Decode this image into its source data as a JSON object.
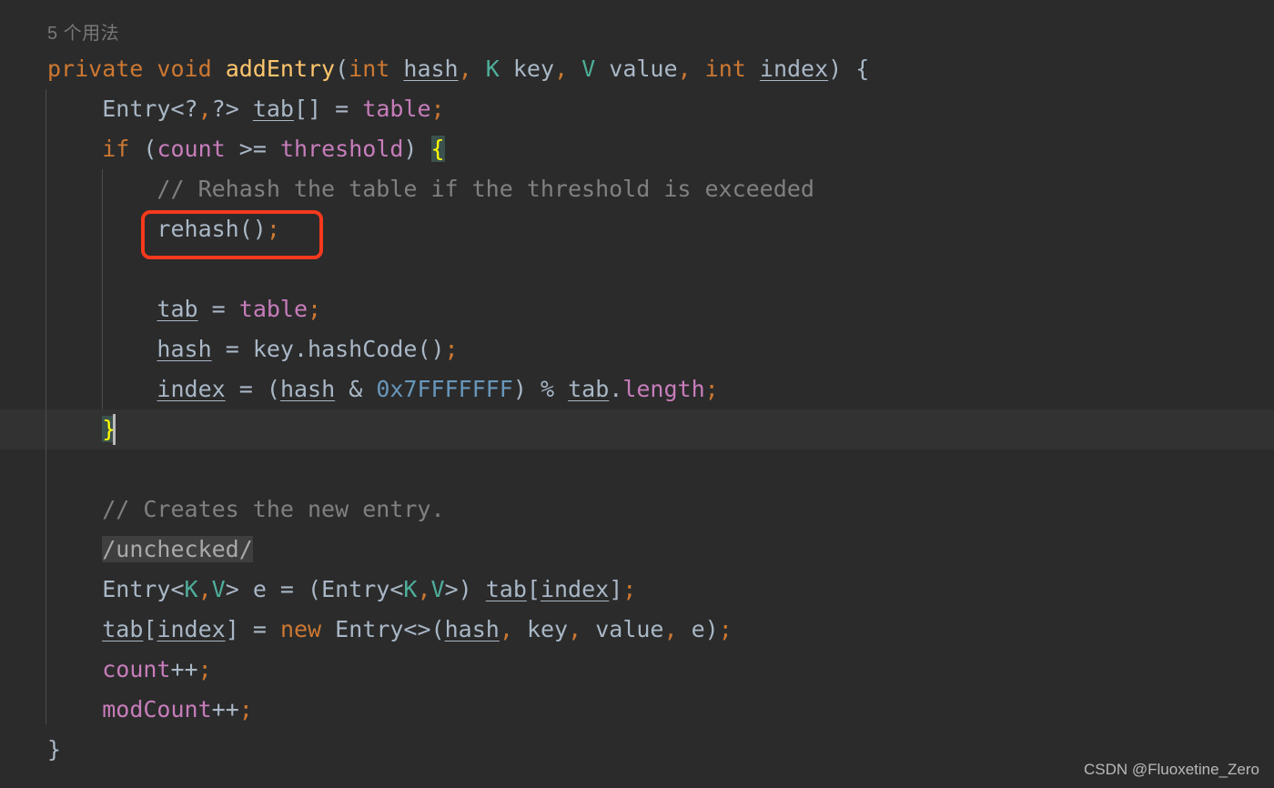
{
  "editor": {
    "background_color": "#2b2b2b",
    "current_line_color": "#323232",
    "code_vision_hint": "5 个用法",
    "watermark": "CSDN @Fluoxetine_Zero",
    "annotation": {
      "kind": "red-rectangle-highlight",
      "color": "#f5391d",
      "targets_line": 5,
      "target_text": "rehash();"
    },
    "caret": {
      "line": 10,
      "column": 5
    },
    "colors": {
      "keyword": "#cc7832",
      "method": "#ffc66d",
      "field": "#c77dbb",
      "default": "#a9b7c6",
      "generic_type": "#4eaf9a",
      "number": "#6897bb",
      "comment": "#808080",
      "brace_match_bg": "#3b514d",
      "brace_match_fg": "#ffff00",
      "folded_bg": "#3f3f3f",
      "accent_red": "#f5391d"
    }
  },
  "code": {
    "line1": {
      "kw_private": "private",
      "sp1": " ",
      "kw_void": "void",
      "sp2": " ",
      "method_name": "addEntry",
      "paren_open": "(",
      "kw_int_a": "int",
      "sp3": " ",
      "param_hash": "hash",
      "comma1": ",",
      "sp4": " ",
      "type_K": "K",
      "sp5": " ",
      "param_key": "key",
      "comma2": ",",
      "sp6": " ",
      "type_V": "V",
      "sp7": " ",
      "param_value": "value",
      "comma3": ",",
      "sp8": " ",
      "kw_int_b": "int",
      "sp9": " ",
      "param_index": "index",
      "paren_close": ")",
      "sp10": " ",
      "brace": "{"
    },
    "line2": {
      "indent": "    ",
      "type_entry": "Entry<?",
      "comma": ",",
      "type_rest": "?>",
      "sp1": " ",
      "var_tab": "tab",
      "brackets": "[]",
      "sp2": " ",
      "eq": "=",
      "sp3": " ",
      "field_table": "table",
      "semi": ";"
    },
    "line3": {
      "indent": "    ",
      "kw_if": "if",
      "sp1": " ",
      "paren_open": "(",
      "field_count": "count",
      "sp2": " ",
      "op": ">=",
      "sp3": " ",
      "field_threshold": "threshold",
      "paren_close": ")",
      "sp4": " ",
      "brace": "{"
    },
    "line4": {
      "indent": "        ",
      "comment": "// Rehash the table if the threshold is exceeded"
    },
    "line5": {
      "indent": "        ",
      "call": "rehash()",
      "semi": ";"
    },
    "line6": {
      "text": ""
    },
    "line7": {
      "indent": "        ",
      "var_tab": "tab",
      "sp1": " ",
      "eq": "=",
      "sp2": " ",
      "field_table": "table",
      "semi": ";"
    },
    "line8": {
      "indent": "        ",
      "var_hash": "hash",
      "sp1": " ",
      "eq": "=",
      "sp2": " ",
      "expr": "key.hashCode()",
      "semi": ";"
    },
    "line9": {
      "indent": "        ",
      "var_index": "index",
      "sp1": " ",
      "eq": "=",
      "sp2": " ",
      "paren_open": "(",
      "var_hash": "hash",
      "sp3": " ",
      "amp": "&",
      "sp4": " ",
      "hex": "0x7FFFFFFF",
      "paren_close": ")",
      "sp5": " ",
      "mod": "%",
      "sp6": " ",
      "var_tab": "tab",
      "dot": ".",
      "field_length": "length",
      "semi": ";"
    },
    "line10": {
      "indent": "    ",
      "brace": "}"
    },
    "line11": {
      "text": ""
    },
    "line12": {
      "indent": "    ",
      "comment": "// Creates the new entry."
    },
    "line13": {
      "indent": "    ",
      "folded": "/unchecked/"
    },
    "line14": {
      "indent": "    ",
      "t1": "Entry<",
      "type_K1": "K",
      "comma1": ",",
      "type_V1": "V",
      "t2": "> e = (Entry<",
      "type_K2": "K",
      "comma2": ",",
      "type_V2": "V",
      "t3": ">) ",
      "var_tab": "tab",
      "b1": "[",
      "var_index": "index",
      "b2": "]",
      "semi": ";"
    },
    "line15": {
      "indent": "    ",
      "var_tab": "tab",
      "b1": "[",
      "var_index": "index",
      "b2": "]",
      "sp1": " ",
      "eq": "=",
      "sp2": " ",
      "kw_new": "new",
      "sp3": " ",
      "t1": "Entry<>(",
      "var_hash": "hash",
      "comma1": ",",
      "sp4": " ",
      "arg_key": "key",
      "comma2": ",",
      "sp5": " ",
      "arg_value": "value",
      "comma3": ",",
      "sp6": " ",
      "arg_e": "e",
      "paren_close": ")",
      "semi": ";"
    },
    "line16": {
      "indent": "    ",
      "field_count": "count",
      "inc": "++",
      "semi": ";"
    },
    "line17": {
      "indent": "    ",
      "field_modcount": "modCount",
      "inc": "++",
      "semi": ";"
    },
    "line18": {
      "brace": "}"
    }
  }
}
